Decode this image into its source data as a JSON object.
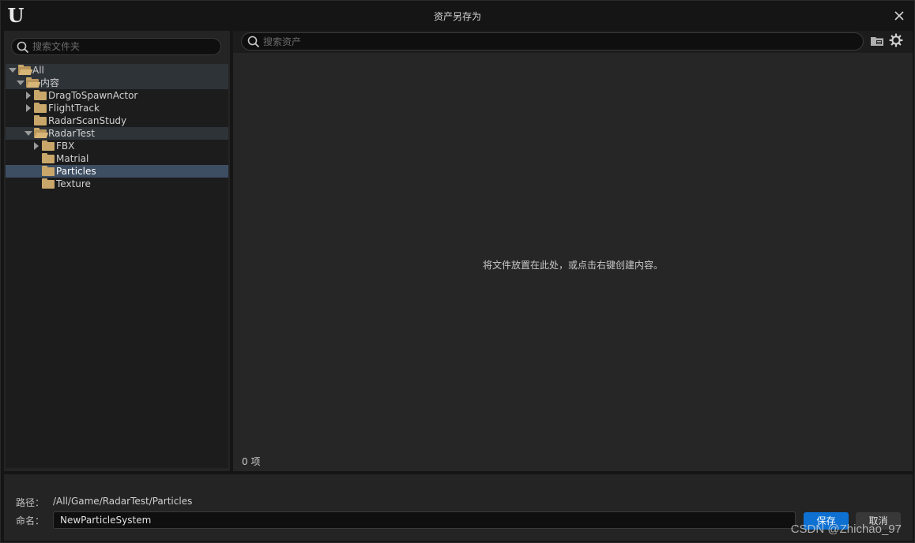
{
  "window": {
    "title": "资产另存为",
    "logo_text": "U"
  },
  "folder_panel": {
    "search_placeholder": "搜索文件夹",
    "tree": [
      {
        "label": "All",
        "expanded": true
      },
      {
        "label": "内容",
        "expanded": true
      },
      {
        "label": "DragToSpawnActor",
        "expanded": false
      },
      {
        "label": "FlightTrack",
        "expanded": false
      },
      {
        "label": "RadarScanStudy"
      },
      {
        "label": "RadarTest",
        "expanded": true
      },
      {
        "label": "FBX",
        "expanded": false
      },
      {
        "label": "Matrial"
      },
      {
        "label": "Particles",
        "selected": true
      },
      {
        "label": "Texture"
      }
    ]
  },
  "asset_panel": {
    "search_placeholder": "搜索资产",
    "empty_message": "将文件放置在此处，或点击右键创建内容。",
    "item_count": "0 项"
  },
  "footer": {
    "path_label": "路径：",
    "path_value": "/All/Game/RadarTest/Particles",
    "name_label": "命名：",
    "name_value": "NewParticleSystem",
    "save_label": "保存",
    "cancel_label": "取消"
  },
  "watermark": "CSDN @Zhichao_97",
  "colors": {
    "accent": "#0e71d2",
    "folder": "#c9a76a",
    "selection": "#3d4e63"
  }
}
